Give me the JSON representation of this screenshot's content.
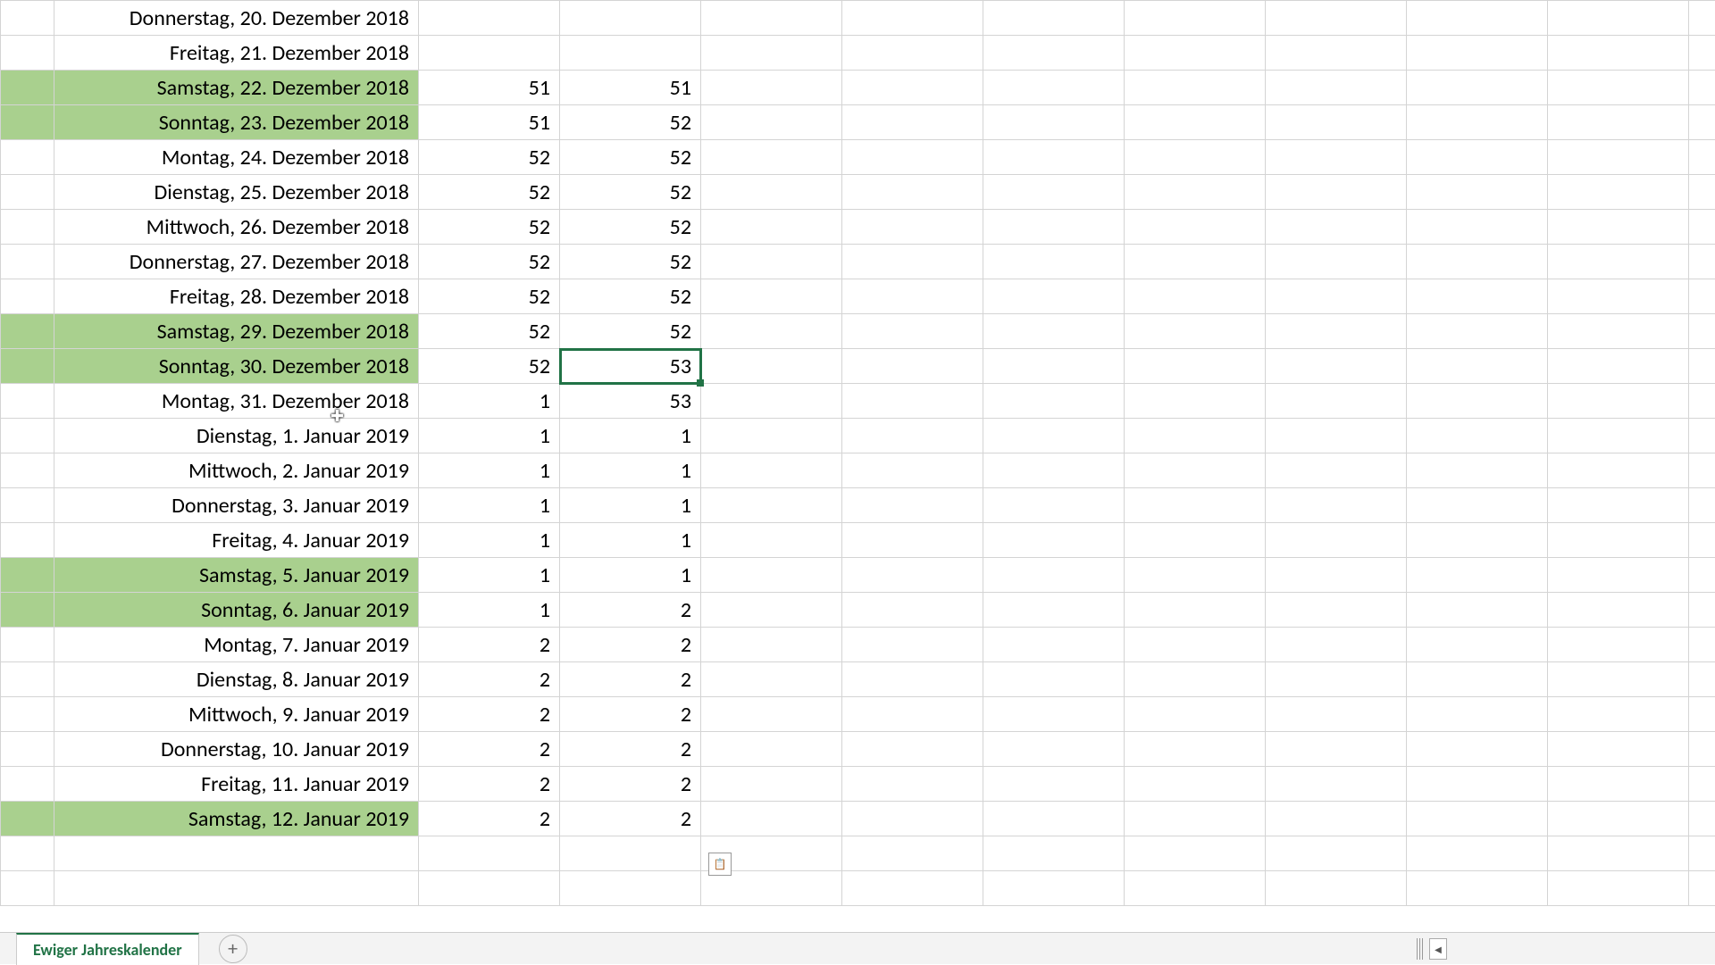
{
  "sheet": {
    "tab_name": "Ewiger Jahreskalender",
    "selected_cell": {
      "row": 10,
      "col": 2
    },
    "rows": [
      {
        "date": "Donnerstag, 20. Dezember 2018",
        "col_b": "",
        "col_c": "",
        "weekend": false
      },
      {
        "date": "Freitag, 21. Dezember 2018",
        "col_b": "",
        "col_c": "",
        "weekend": false
      },
      {
        "date": "Samstag, 22. Dezember 2018",
        "col_b": "51",
        "col_c": "51",
        "weekend": true
      },
      {
        "date": "Sonntag, 23. Dezember 2018",
        "col_b": "51",
        "col_c": "52",
        "weekend": true
      },
      {
        "date": "Montag, 24. Dezember 2018",
        "col_b": "52",
        "col_c": "52",
        "weekend": false
      },
      {
        "date": "Dienstag, 25. Dezember 2018",
        "col_b": "52",
        "col_c": "52",
        "weekend": false
      },
      {
        "date": "Mittwoch, 26. Dezember 2018",
        "col_b": "52",
        "col_c": "52",
        "weekend": false
      },
      {
        "date": "Donnerstag, 27. Dezember 2018",
        "col_b": "52",
        "col_c": "52",
        "weekend": false
      },
      {
        "date": "Freitag, 28. Dezember 2018",
        "col_b": "52",
        "col_c": "52",
        "weekend": false
      },
      {
        "date": "Samstag, 29. Dezember 2018",
        "col_b": "52",
        "col_c": "52",
        "weekend": true
      },
      {
        "date": "Sonntag, 30. Dezember 2018",
        "col_b": "52",
        "col_c": "53",
        "weekend": true
      },
      {
        "date": "Montag, 31. Dezember 2018",
        "col_b": "1",
        "col_c": "53",
        "weekend": false
      },
      {
        "date": "Dienstag, 1. Januar 2019",
        "col_b": "1",
        "col_c": "1",
        "weekend": false
      },
      {
        "date": "Mittwoch, 2. Januar 2019",
        "col_b": "1",
        "col_c": "1",
        "weekend": false
      },
      {
        "date": "Donnerstag, 3. Januar 2019",
        "col_b": "1",
        "col_c": "1",
        "weekend": false
      },
      {
        "date": "Freitag, 4. Januar 2019",
        "col_b": "1",
        "col_c": "1",
        "weekend": false
      },
      {
        "date": "Samstag, 5. Januar 2019",
        "col_b": "1",
        "col_c": "1",
        "weekend": true
      },
      {
        "date": "Sonntag, 6. Januar 2019",
        "col_b": "1",
        "col_c": "2",
        "weekend": true
      },
      {
        "date": "Montag, 7. Januar 2019",
        "col_b": "2",
        "col_c": "2",
        "weekend": false
      },
      {
        "date": "Dienstag, 8. Januar 2019",
        "col_b": "2",
        "col_c": "2",
        "weekend": false
      },
      {
        "date": "Mittwoch, 9. Januar 2019",
        "col_b": "2",
        "col_c": "2",
        "weekend": false
      },
      {
        "date": "Donnerstag, 10. Januar 2019",
        "col_b": "2",
        "col_c": "2",
        "weekend": false
      },
      {
        "date": "Freitag, 11. Januar 2019",
        "col_b": "2",
        "col_c": "2",
        "weekend": false
      },
      {
        "date": "Samstag, 12. Januar 2019",
        "col_b": "2",
        "col_c": "2",
        "weekend": true
      },
      {
        "date": "",
        "col_b": "",
        "col_c": "",
        "weekend": false
      },
      {
        "date": "",
        "col_b": "",
        "col_c": "",
        "weekend": false
      }
    ]
  },
  "colors": {
    "weekend_highlight": "#a9d08e",
    "selection_border": "#217346",
    "grid_line": "#d4d4d4"
  }
}
